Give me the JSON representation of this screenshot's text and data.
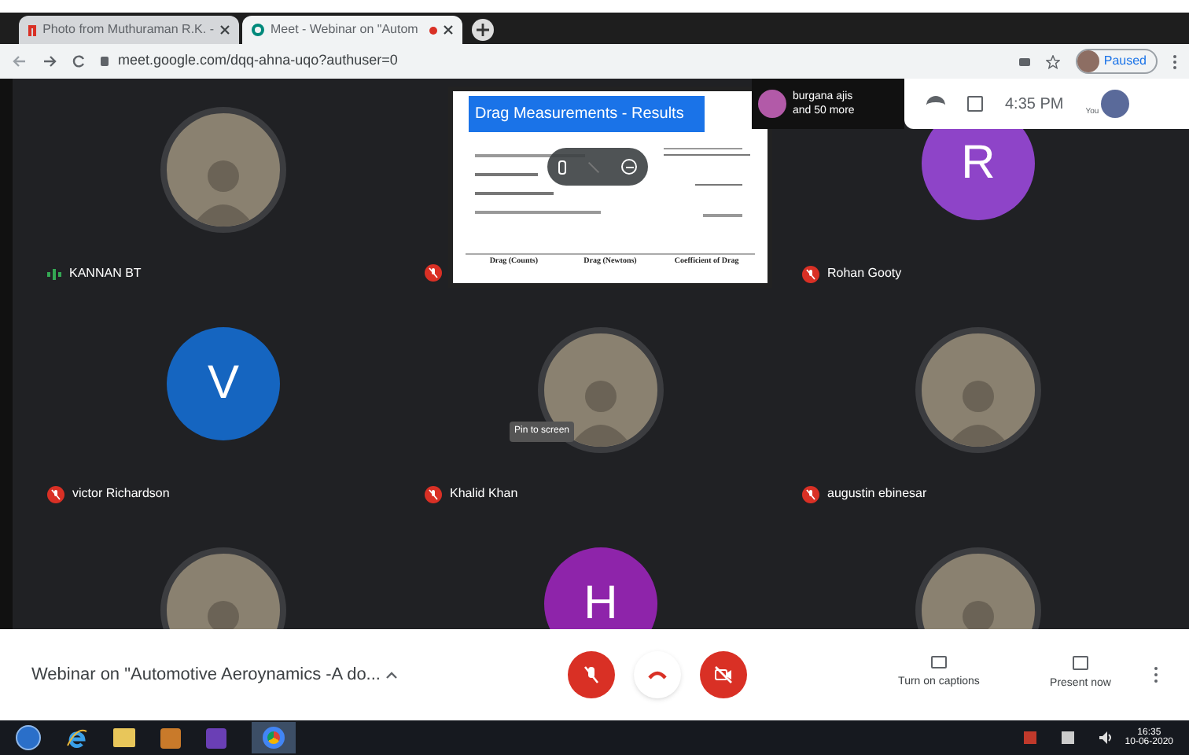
{
  "browser": {
    "tabs": [
      {
        "title": "Photo from Muthuraman R.K. -",
        "selected": false,
        "kind": "gmail"
      },
      {
        "title": "Meet - Webinar on \"Autom",
        "selected": true,
        "kind": "meet"
      }
    ],
    "url": "meet.google.com/dqq-ahna-uqo?authuser=0",
    "profile_status": "Paused"
  },
  "presentation": {
    "title": "Drag Measurements - Results",
    "table_columns": [
      "Drag (Counts)",
      "Drag (Newtons)",
      "Coefficient of Drag"
    ]
  },
  "participants_chip": {
    "name": "burgana ajis",
    "more": "and 50 more"
  },
  "header": {
    "time": "4:35 PM",
    "self_label": "You"
  },
  "tiles": [
    {
      "name": "KANNAN BT",
      "kind": "photo",
      "muted": false
    },
    {
      "kind": "hidden",
      "muted": true
    },
    {
      "name": "Rohan Gooty",
      "kind": "letter",
      "letter": "R",
      "color": "#8e44c8",
      "muted": true
    },
    {
      "name": "victor Richardson",
      "kind": "letter",
      "letter": "V",
      "color": "#1565c0",
      "muted": true
    },
    {
      "name": "Khalid Khan",
      "kind": "photo",
      "muted": true,
      "tooltip": "Pin to screen"
    },
    {
      "name": "augustin ebinesar",
      "kind": "photo",
      "muted": true
    },
    {
      "kind": "photo"
    },
    {
      "kind": "letter",
      "letter": "H",
      "color": "#8e24aa"
    },
    {
      "kind": "photo"
    }
  ],
  "meeting_title": "Webinar on \"Automotive Aeroynamics -A do...",
  "actions": [
    {
      "label": "Turn on captions",
      "kind": "captions"
    },
    {
      "label": "Present now",
      "kind": "present"
    }
  ],
  "taskbar": {
    "time": "16:35",
    "date": "10-06-2020"
  }
}
